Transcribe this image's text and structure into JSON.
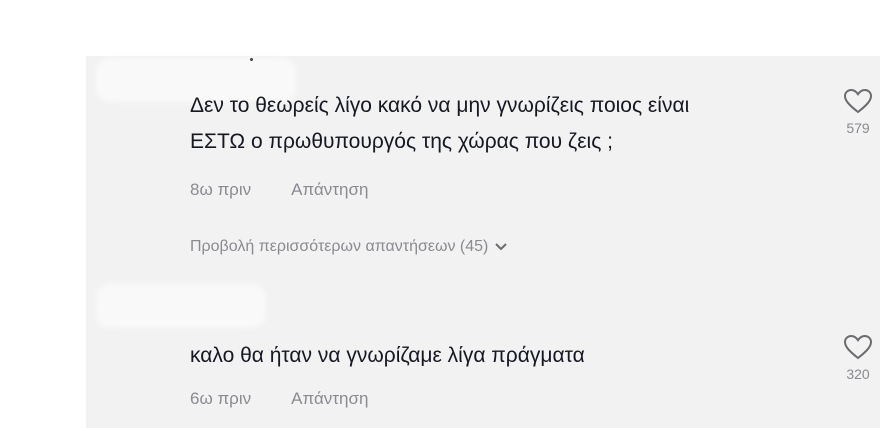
{
  "comments": [
    {
      "text_line1": "Δεν το θεωρείς λίγο κακό να μην γνωρίζεις ποιος είναι",
      "text_line2": "ΕΣΤΩ ο πρωθυπουργός της χώρας που ζεις ;",
      "time": "8ω πριν",
      "reply_label": "Απάντηση",
      "likes": "579",
      "more_replies": "Προβολή περισσότερων απαντήσεων (45)"
    },
    {
      "text_line1": "καλο θα ήταν να γνωρίζαμε λίγα πράγματα",
      "time": "6ω πριν",
      "reply_label": "Απάντηση",
      "likes": "320"
    }
  ],
  "colors": {
    "text": "#161823",
    "muted": "#8a8b91",
    "panel": "#f2f2f2"
  },
  "icons": [
    "heart-icon",
    "chevron-down-icon"
  ]
}
